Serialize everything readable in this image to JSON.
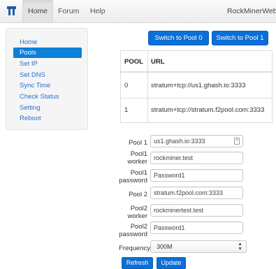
{
  "navbar": {
    "tabs": [
      "Home",
      "Forum",
      "Help"
    ],
    "active_tab": "Home",
    "brand": "RockMinerWeb v"
  },
  "sidebar": {
    "items": [
      "Home",
      "Pools",
      "Set IP",
      "Set DNS",
      "Sync Time",
      "Check Status",
      "Setting",
      "Reboot"
    ],
    "active_item": "Pools"
  },
  "actions": {
    "switch_pool0": "Switch to Pool 0",
    "switch_pool1": "Switch to Pool 1"
  },
  "pool_table": {
    "headers": [
      "POOL",
      "URL"
    ],
    "rows": [
      [
        "0",
        "stratum+tcp://us1.ghash.io:3333"
      ],
      [
        "1",
        "stratum+tcp://stratum.f2pool.com:3333"
      ]
    ]
  },
  "form": {
    "pool1_label": "Pool 1",
    "pool1_value": "us1.ghash.io:3333",
    "pool1_worker_label": [
      "Pool1",
      "worker"
    ],
    "pool1_worker_value": "rockminer.test",
    "pool1_password_label": [
      "Pool1",
      "password"
    ],
    "pool1_password_value": "Password1",
    "pool2_label": "Pool 2",
    "pool2_value": "stratum.f2pool.com:3333",
    "pool2_worker_label": [
      "Pool2",
      "worker"
    ],
    "pool2_worker_value": "rockminertest.test",
    "pool2_password_label": [
      "Pool2",
      "password"
    ],
    "pool2_password_value": "Password1",
    "frequency_label": "Frequency",
    "frequency_value": "300M",
    "refresh_label": "Refresh",
    "update_label": "Update"
  },
  "colors": {
    "primary": "#0b6fd6",
    "link": "#2a6fc9",
    "active_side": "#0d80d8"
  }
}
